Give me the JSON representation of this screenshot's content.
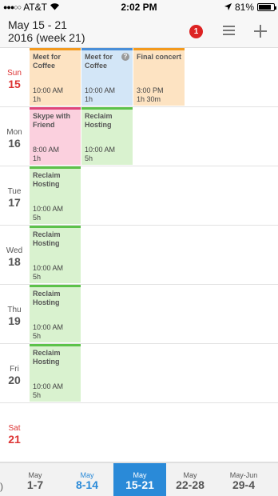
{
  "status_bar": {
    "carrier": "AT&T",
    "time": "2:02 PM",
    "battery": "81%",
    "battery_level": 0.81
  },
  "header": {
    "title_line1": "May 15 - 21",
    "title_line2": "2016 (week 21)",
    "badge_count": "1",
    "icons": [
      "menu-icon",
      "plus-icon"
    ]
  },
  "days": [
    {
      "name": "Sun",
      "num": "15",
      "weekend": true,
      "events": [
        {
          "title": "Meet for Coffee",
          "time": "10:00 AM",
          "duration": "1h",
          "color": "orange"
        },
        {
          "title": "Meet for Coffee",
          "time": "10:00 AM",
          "duration": "1h",
          "color": "blue",
          "help_icon": "?"
        },
        {
          "title": "Final concert",
          "time": "3:00 PM",
          "duration": "1h 30m",
          "color": "orange"
        }
      ]
    },
    {
      "name": "Mon",
      "num": "16",
      "weekend": false,
      "events": [
        {
          "title": "Skype with Friend",
          "time": "8:00 AM",
          "duration": "1h",
          "color": "pink"
        },
        {
          "title": "Reclaim Hosting",
          "time": "10:00 AM",
          "duration": "5h",
          "color": "green"
        }
      ]
    },
    {
      "name": "Tue",
      "num": "17",
      "weekend": false,
      "events": [
        {
          "title": "Reclaim Hosting",
          "time": "10:00 AM",
          "duration": "5h",
          "color": "green"
        }
      ]
    },
    {
      "name": "Wed",
      "num": "18",
      "weekend": false,
      "events": [
        {
          "title": "Reclaim Hosting",
          "time": "10:00 AM",
          "duration": "5h",
          "color": "green"
        }
      ]
    },
    {
      "name": "Thu",
      "num": "19",
      "weekend": false,
      "events": [
        {
          "title": "Reclaim Hosting",
          "time": "10:00 AM",
          "duration": "5h",
          "color": "green"
        }
      ]
    },
    {
      "name": "Fri",
      "num": "20",
      "weekend": false,
      "events": [
        {
          "title": "Reclaim Hosting",
          "time": "10:00 AM",
          "duration": "5h",
          "color": "green"
        }
      ]
    },
    {
      "name": "Sat",
      "num": "21",
      "weekend": true,
      "events": []
    }
  ],
  "week_nav": {
    "weeks": [
      {
        "month": "May",
        "range": "1-7",
        "state": ""
      },
      {
        "month": "May",
        "range": "8-14",
        "state": "today"
      },
      {
        "month": "May",
        "range": "15-21",
        "state": "selected"
      },
      {
        "month": "May",
        "range": "22-28",
        "state": ""
      },
      {
        "month": "May-Jun",
        "range": "29-4",
        "state": ""
      }
    ]
  },
  "colors": {
    "accent": "#2a8ad8",
    "weekend": "#dd3333",
    "orange": "#fde3c2",
    "blue": "#d3e6f7",
    "pink": "#fbd0de",
    "green": "#d9f2cf"
  }
}
